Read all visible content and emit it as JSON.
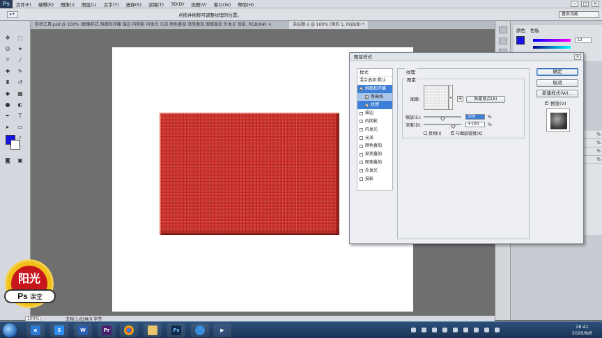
{
  "app": {
    "logo": "Ps"
  },
  "menu": [
    "文件(F)",
    "编辑(E)",
    "图像(I)",
    "图层(L)",
    "文字(Y)",
    "选择(S)",
    "滤镜(T)",
    "3D(D)",
    "视图(V)",
    "窗口(W)",
    "帮助(H)"
  ],
  "options": {
    "hint": "点按并拖移可调整纹理的位置。",
    "workspace": "基本功能"
  },
  "tabs": [
    {
      "label": "形状工具.psd @ 100% (图像样式 斜面和浮雕 描边 内阴影 内发光 光泽 颜色叠加 渐变叠加 图案叠加 外发光 投影, RGB/8#) ×"
    },
    {
      "label": "未标题-1 @ 100% (矩形 1, RGB/8) *"
    }
  ],
  "status": {
    "zoom": "100%",
    "doc_info": "文档:1.83M/0 字节"
  },
  "colors": {
    "foreground": "#1515e6",
    "background": "#ffffff",
    "shape": "#d4302a"
  },
  "right_panel": {
    "tabs": [
      "颜色",
      "色板"
    ],
    "r_value": "12",
    "lower_rows": [
      "%",
      "%",
      "%",
      "%"
    ]
  },
  "dialog": {
    "title": "图层样式",
    "styles_header": "样式",
    "blend_options": "混合选项:默认",
    "items": [
      {
        "label": "斜面和浮雕",
        "checked": true,
        "state": "selected"
      },
      {
        "label": "等高线",
        "checked": true,
        "state": "sub"
      },
      {
        "label": "纹理",
        "checked": true,
        "state": "sub-active"
      },
      {
        "label": "描边",
        "checked": false
      },
      {
        "label": "内阴影",
        "checked": false
      },
      {
        "label": "内发光",
        "checked": false
      },
      {
        "label": "光泽",
        "checked": false
      },
      {
        "label": "颜色叠加",
        "checked": false
      },
      {
        "label": "渐变叠加",
        "checked": false
      },
      {
        "label": "图案叠加",
        "checked": false
      },
      {
        "label": "外发光",
        "checked": false
      },
      {
        "label": "投影",
        "checked": false
      }
    ],
    "section_title": "纹理",
    "subsection_title": "图素",
    "pattern_label": "图案:",
    "snap_button": "贴紧原点(A)",
    "scale_label": "缩放(S):",
    "scale_value": "100",
    "depth_label": "深度(D):",
    "depth_value": "+100",
    "percent": "%",
    "invert_label": "反相(I)",
    "link_label": "与图层链接(K)",
    "ok": "确定",
    "cancel": "取消",
    "new_style": "新建样式(W)...",
    "preview": "预览(V)"
  },
  "taskbar": {
    "time": "18:41",
    "date": "2020/9/6"
  },
  "badge": {
    "title": "阳光",
    "ps": "Ps",
    "course": "课堂"
  }
}
